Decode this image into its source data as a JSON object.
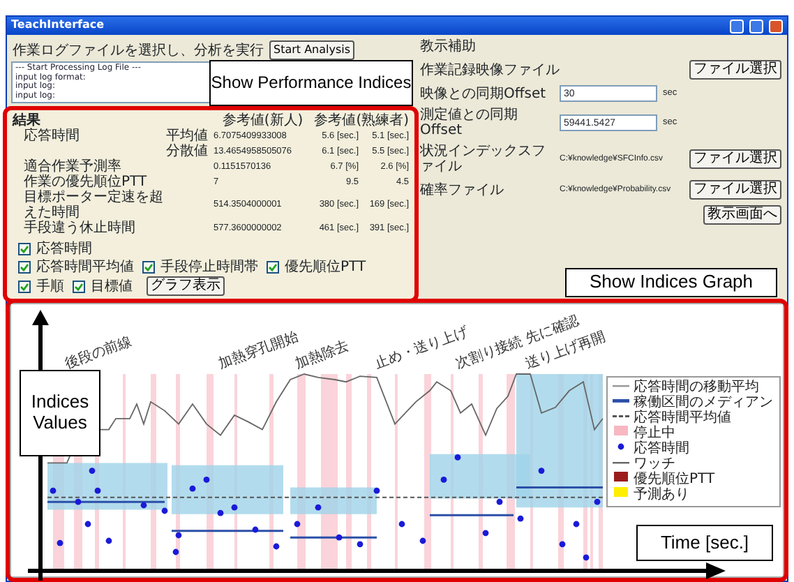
{
  "window": {
    "title": "TeachInterface"
  },
  "analysis": {
    "prompt": "作業ログファイルを選択し、分析を実行",
    "button": "Start Analysis",
    "log": [
      "--- Start Processing Log File ---",
      "input log format:",
      "input log:",
      "input log:"
    ]
  },
  "results": {
    "title": "結果",
    "headers": [
      "参考値(新人)",
      "参考値(熟練者)"
    ],
    "rows": [
      {
        "label": "応答時間",
        "sublabel": "平均値",
        "value": "6.7075409933008",
        "novice": "5.6 [sec.]",
        "expert": "5.1 [sec.]"
      },
      {
        "label": "",
        "sublabel": "分散値",
        "value": "13.4654958505076",
        "novice": "6.1 [sec.]",
        "expert": "5.5 [sec.]"
      },
      {
        "label": "適合作業予測率",
        "sublabel": "",
        "value": "0.1151570136",
        "novice": "6.7 [%]",
        "expert": "2.6 [%]"
      },
      {
        "label": "作業の優先順位PTT",
        "sublabel": "",
        "value": "7",
        "novice": "9.5",
        "expert": "4.5"
      },
      {
        "label": "目標ポーター定速を超えた時間",
        "sublabel": "",
        "value": "514.3504000001",
        "novice": "380 [sec.]",
        "expert": "169 [sec.]"
      },
      {
        "label": "手段違う休止時間",
        "sublabel": "",
        "value": "577.3600000002",
        "novice": "461 [sec.]",
        "expert": "391 [sec.]"
      }
    ],
    "checkboxes": [
      {
        "label": "応答時間",
        "checked": true
      },
      {
        "label": "応答時間平均値",
        "checked": true
      },
      {
        "label": "手段停止時間帯",
        "checked": true
      },
      {
        "label": "優先順位PTT",
        "checked": true
      },
      {
        "label": "手順",
        "checked": true
      },
      {
        "label": "目標値",
        "checked": true
      }
    ],
    "graph_button": "グラフ表示"
  },
  "settings": {
    "title": "教示補助",
    "rows": [
      {
        "kind": "file",
        "label": "作業記録映像ファイル",
        "button": "ファイル選択"
      },
      {
        "kind": "offset",
        "label": "映像との同期Offset",
        "value": "30",
        "unit": "sec"
      },
      {
        "kind": "offset",
        "label": "測定値との同期Offset",
        "value": "59441.5427",
        "unit": "sec"
      },
      {
        "kind": "path",
        "label": "状況インデックスファイル",
        "value": "C:¥knowledge¥SFCInfo.csv",
        "button": "ファイル選択"
      },
      {
        "kind": "path",
        "label": "確率ファイル",
        "value": "C:¥knowledge¥Probability.csv",
        "button": "ファイル選択"
      }
    ],
    "teach_button": "教示画面へ"
  },
  "graph": {
    "annotations": [
      "後段の前線",
      "加熱穿孔開始",
      "加熱除去",
      "止め・送り上げ",
      "次割り接続 先に確認",
      "送り上げ再開"
    ],
    "legend": [
      {
        "kind": "line",
        "label": "応答時間の移動平均",
        "color": "#999999"
      },
      {
        "kind": "bar",
        "label": "稼働区間のメディアン",
        "color": "#2b4fa8"
      },
      {
        "kind": "dash",
        "label": "応答時間平均値",
        "color": "#555555"
      },
      {
        "kind": "swatch",
        "label": "停止中",
        "color": "#f7b8c2"
      },
      {
        "kind": "dot",
        "label": "応答時間",
        "color": "#1a1ad8"
      },
      {
        "kind": "line",
        "label": "ワッチ",
        "color": "#666666"
      },
      {
        "kind": "swatch",
        "label": "優先順位PTT",
        "color": "#9b1c1c"
      },
      {
        "kind": "swatch",
        "label": "予測あり",
        "color": "#ffee00"
      }
    ]
  },
  "callouts": [
    "Show Performance Indices",
    "Show Indices Graph",
    "Indices Values",
    "Time [sec.]"
  ]
}
